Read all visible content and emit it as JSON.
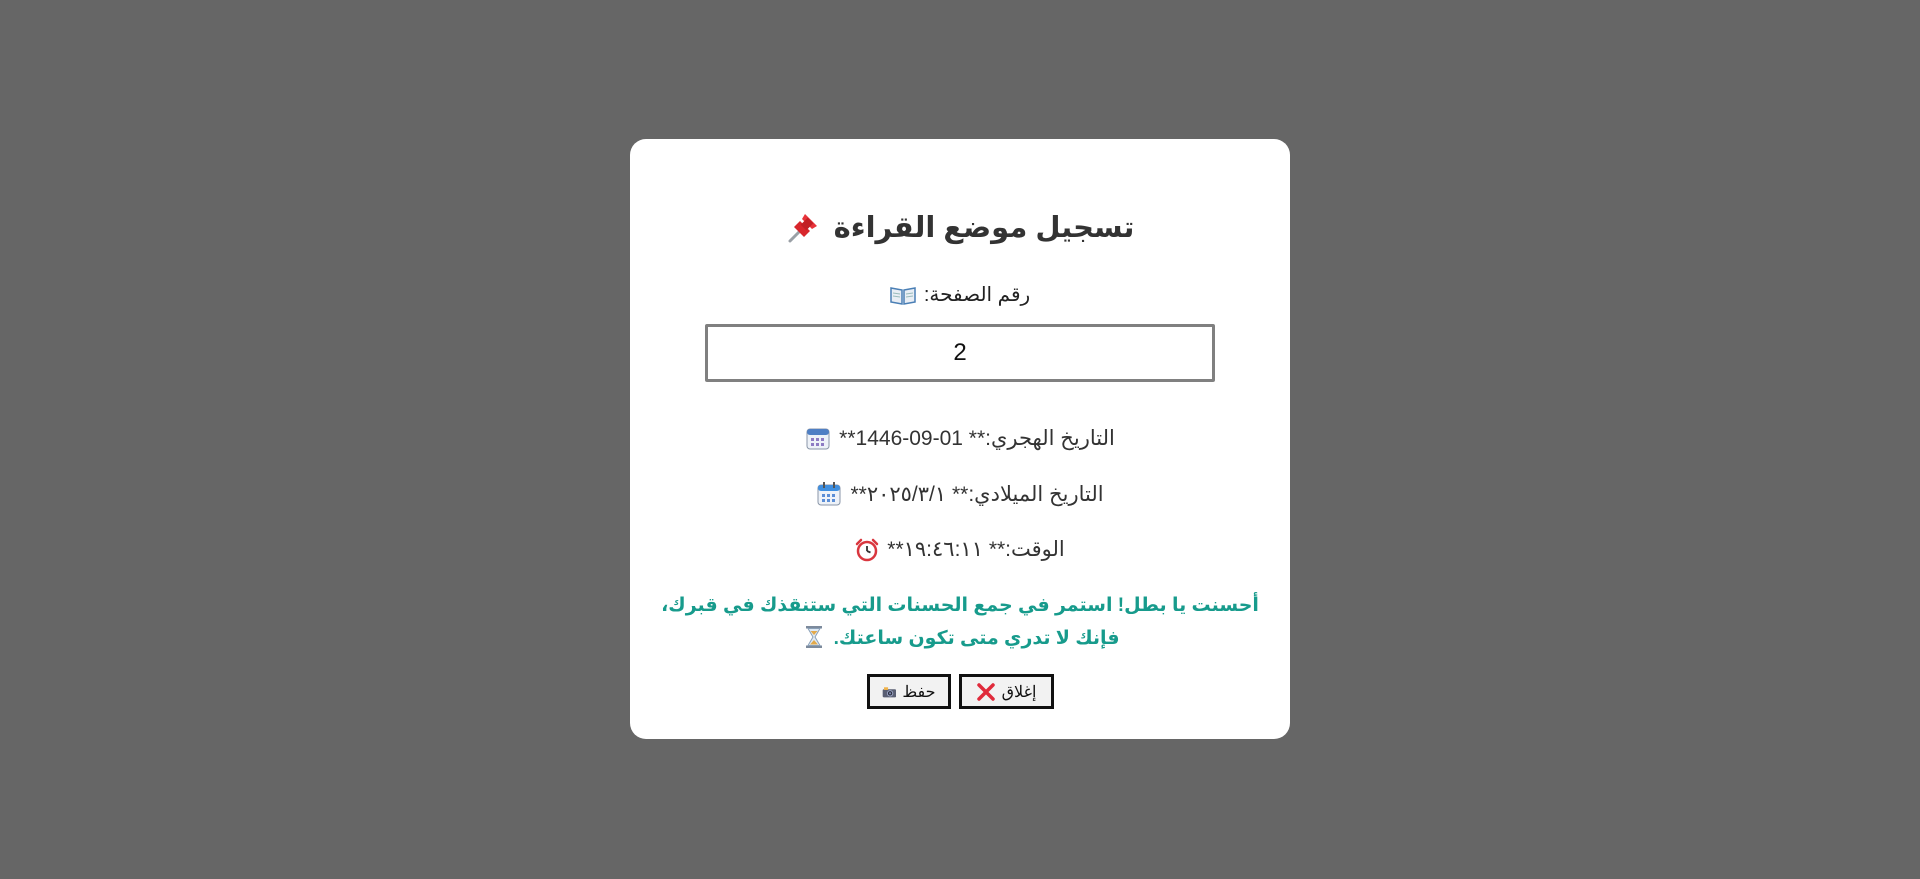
{
  "modal": {
    "title": "تسجيل موضع القراءة",
    "title_icon": "pushpin-icon",
    "page_label": "رقم الصفحة:",
    "page_label_icon": "open-book-icon",
    "page_input_value": "2",
    "hijri_line": "التاريخ الهجري:** 01-09-1446**",
    "hijri_icon": "calendar-icon",
    "gregorian_line": "التاريخ الميلادي:** ٢٠٢٥/٣/١**",
    "gregorian_icon": "calendar-icon",
    "time_line": "الوقت:** ١٩:٤٦:١١**",
    "time_icon": "alarm-clock-icon",
    "motivation_text": "أحسنت يا بطل! استمر في جمع الحسنات التي ستنقذك في قبرك، فإنك لا تدري متى تكون ساعتك.",
    "motivation_icon": "hourglass-icon",
    "close_label": "إغلاق",
    "close_icon": "cross-mark-icon",
    "save_label": "حفظ",
    "save_icon": "camera-icon"
  },
  "colors": {
    "overlay": "#666666",
    "modal_bg": "#ffffff",
    "motivation": "#179b8c",
    "title": "#333333"
  }
}
